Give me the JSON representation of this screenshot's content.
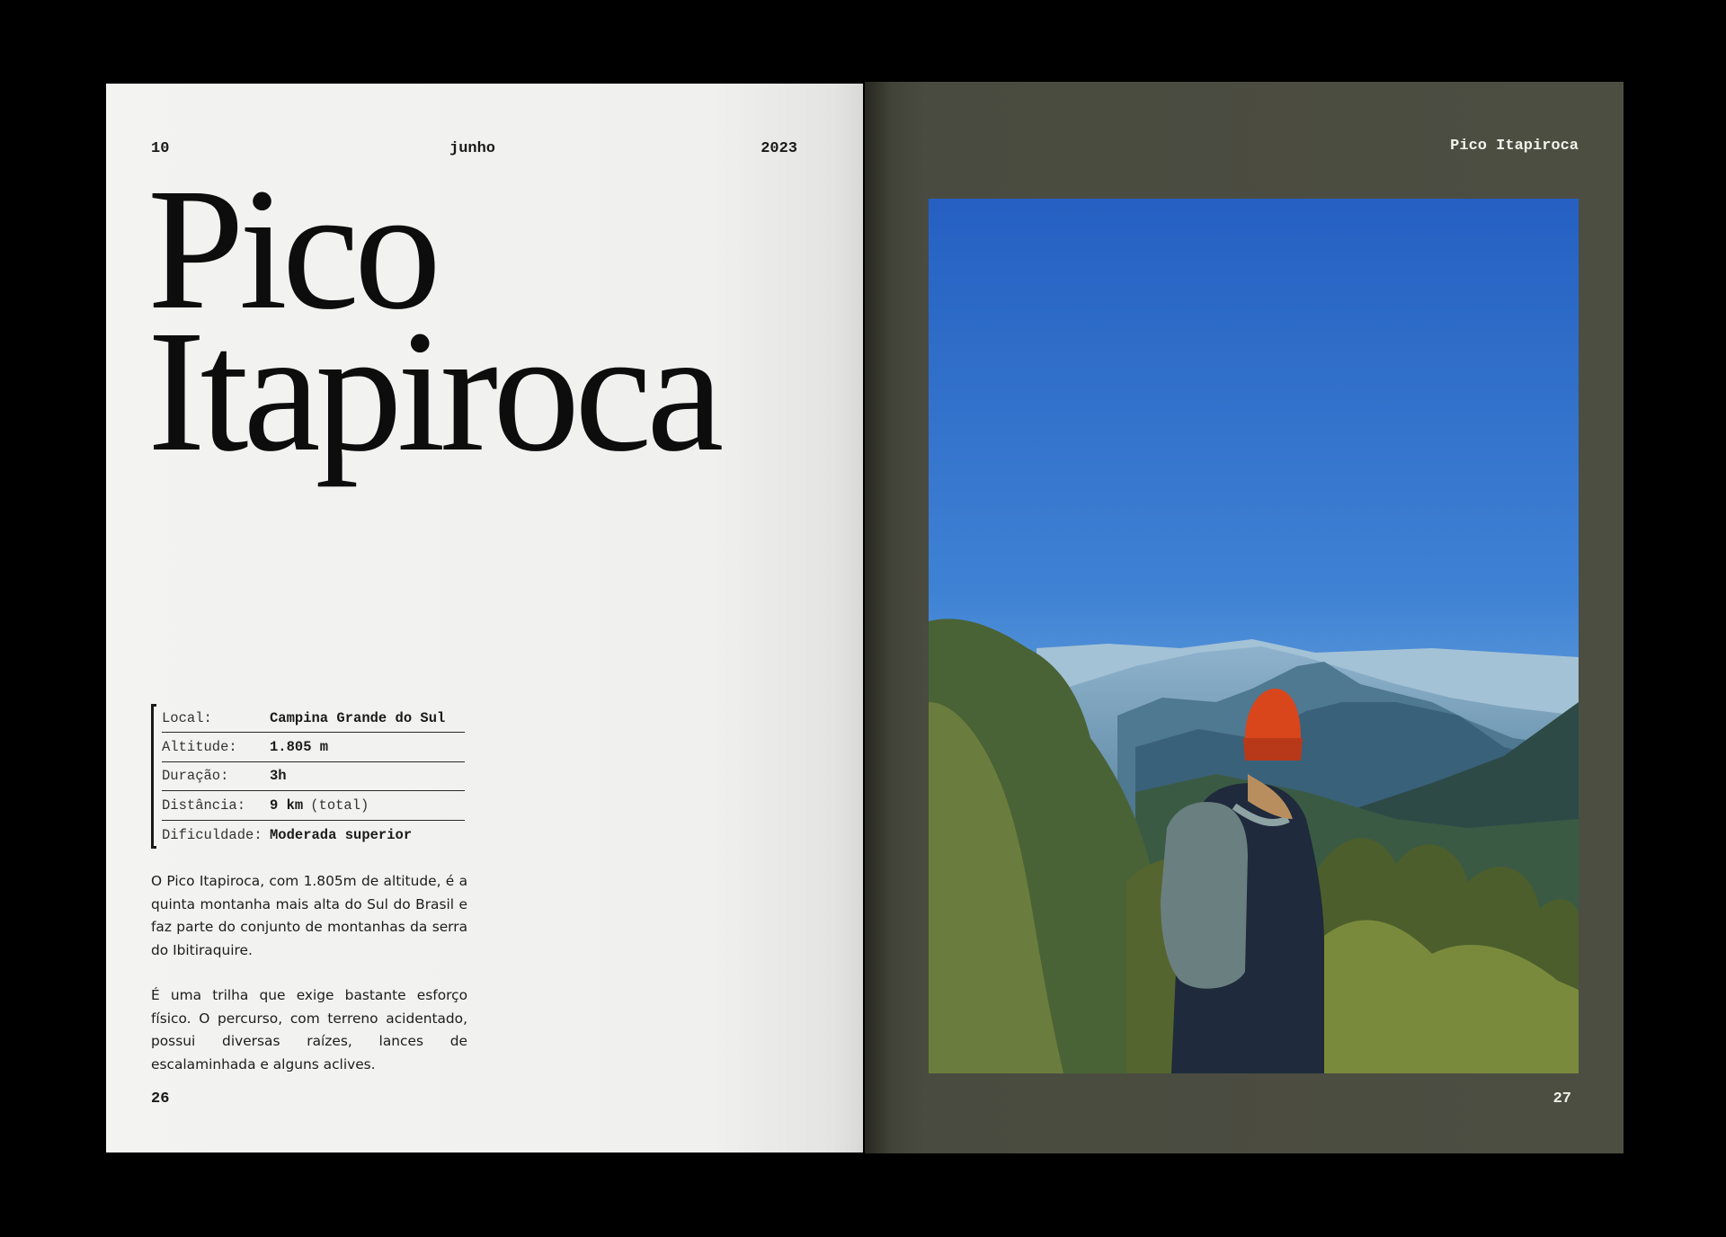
{
  "left_page": {
    "header": {
      "day": "10",
      "month": "junho",
      "year": "2023"
    },
    "title_lines": [
      "Pico",
      "Itapiroca"
    ],
    "info": [
      {
        "label": "Local:",
        "value": "Campina Grande do Sul",
        "note": ""
      },
      {
        "label": "Altitude:",
        "value": "1.805 m",
        "note": ""
      },
      {
        "label": "Duração:",
        "value": "3h",
        "note": ""
      },
      {
        "label": "Distância:",
        "value": "9 km",
        "note": "(total)"
      },
      {
        "label": "Dificuldade:",
        "value": "Moderada superior",
        "note": ""
      }
    ],
    "paragraphs": [
      "O Pico Itapiroca, com 1.805m de altitude, é a quinta montanha mais alta do Sul do Brasil e faz parte do conjunto de montanhas da serra do Ibitiraquire.",
      "É uma trilha que exige bastante esforço físico. O percurso, com terreno acidentado, possui diversas raízes, lances de escalaminhada e alguns aclives."
    ],
    "page_number": "26"
  },
  "right_page": {
    "header": "Pico Itapiroca",
    "page_number": "27"
  },
  "colors": {
    "left_paper": "#f0f0ee",
    "right_paper": "#4d4e42",
    "sky_top": "#2a64c4",
    "sky_horizon": "#9cc6e0",
    "hat": "#d9461c"
  }
}
